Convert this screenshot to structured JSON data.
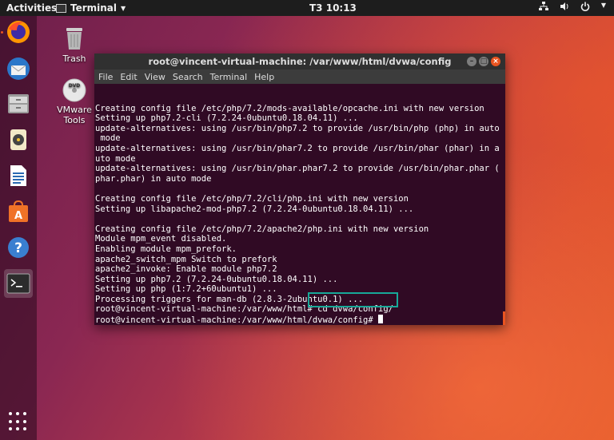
{
  "topbar": {
    "activities": "Activities",
    "app_menu": "Terminal",
    "clock": "T3 10:13"
  },
  "desktop": {
    "trash": "Trash",
    "vmware_line1": "VMware",
    "vmware_line2": "Tools",
    "dvd_label": "DVD"
  },
  "window": {
    "title": "root@vincent-virtual-machine: /var/www/html/dvwa/config",
    "menu": [
      "File",
      "Edit",
      "View",
      "Search",
      "Terminal",
      "Help"
    ]
  },
  "terminal": {
    "lines": [
      "",
      "Creating config file /etc/php/7.2/mods-available/opcache.ini with new version",
      "Setting up php7.2-cli (7.2.24-0ubuntu0.18.04.11) ...",
      "update-alternatives: using /usr/bin/php7.2 to provide /usr/bin/php (php) in auto",
      " mode",
      "update-alternatives: using /usr/bin/phar7.2 to provide /usr/bin/phar (phar) in a",
      "uto mode",
      "update-alternatives: using /usr/bin/phar.phar7.2 to provide /usr/bin/phar.phar (",
      "phar.phar) in auto mode",
      "",
      "Creating config file /etc/php/7.2/cli/php.ini with new version",
      "Setting up libapache2-mod-php7.2 (7.2.24-0ubuntu0.18.04.11) ...",
      "",
      "Creating config file /etc/php/7.2/apache2/php.ini with new version",
      "Module mpm_event disabled.",
      "Enabling module mpm_prefork.",
      "apache2_switch_mpm Switch to prefork",
      "apache2_invoke: Enable module php7.2",
      "Setting up php7.2 (7.2.24-0ubuntu0.18.04.11) ...",
      "Setting up php (1:7.2+60ubuntu1) ...",
      "Processing triggers for man-db (2.8.3-2ubuntu0.1) ...",
      "root@vincent-virtual-machine:/var/www/html# cd dvwa/config/"
    ],
    "prompt": "root@vincent-virtual-machine:/var/www/html/dvwa/config# "
  }
}
